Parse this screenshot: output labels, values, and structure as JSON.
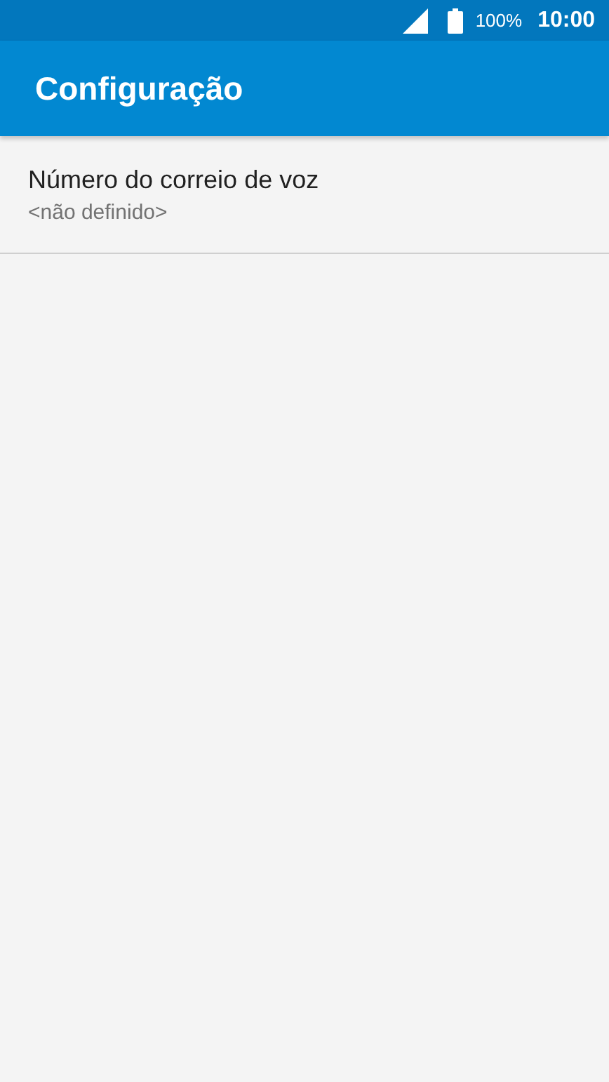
{
  "status_bar": {
    "battery": "100%",
    "time": "10:00"
  },
  "app_bar": {
    "title": "Configuração"
  },
  "settings": [
    {
      "title": "Número do correio de voz",
      "summary": "<não definido>"
    }
  ]
}
